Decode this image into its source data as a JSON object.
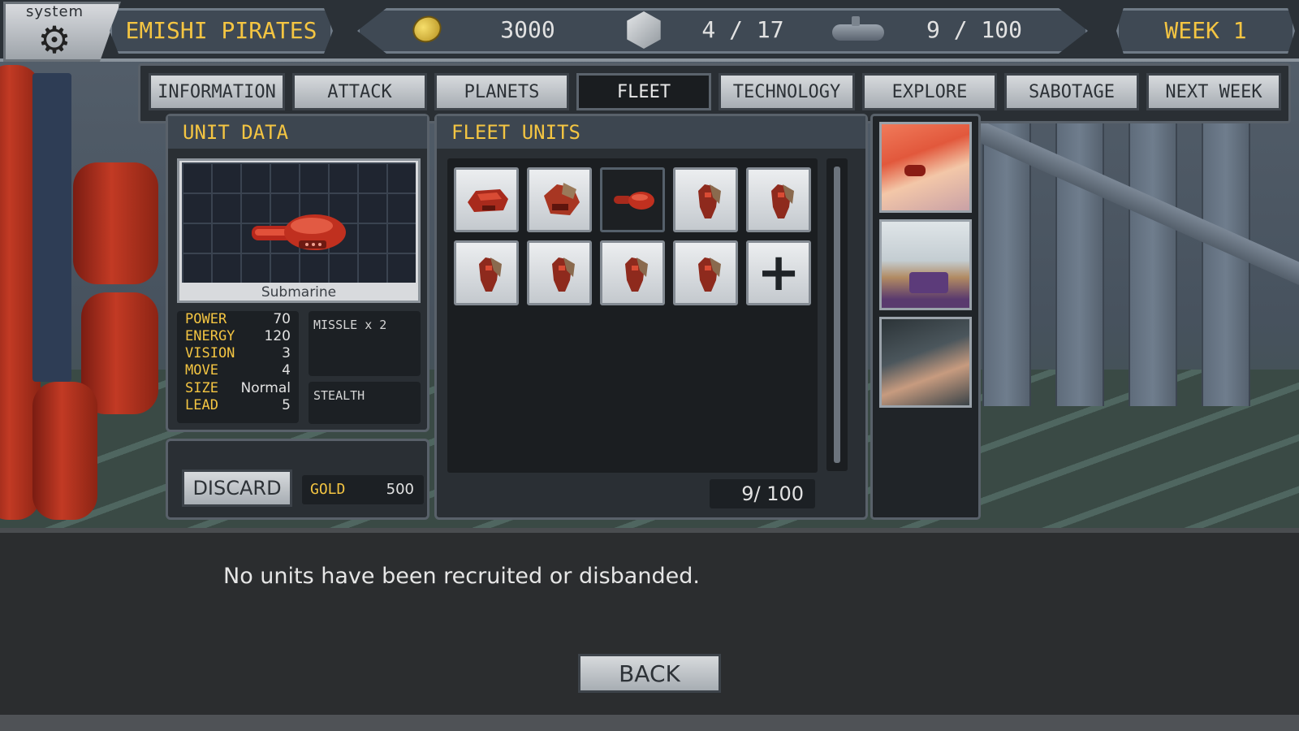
{
  "header": {
    "system_label": "system",
    "faction_name": "EMISHI PIRATES",
    "gold": "3000",
    "planets": "4 / 17",
    "fleet": "9 / 100",
    "week": "WEEK  1"
  },
  "tabs": [
    {
      "label": "INFORMATION",
      "active": false
    },
    {
      "label": "ATTACK",
      "active": false
    },
    {
      "label": "PLANETS",
      "active": false
    },
    {
      "label": "FLEET",
      "active": true
    },
    {
      "label": "TECHNOLOGY",
      "active": false
    },
    {
      "label": "EXPLORE",
      "active": false
    },
    {
      "label": "SABOTAGE",
      "active": false
    },
    {
      "label": "NEXT WEEK",
      "active": false
    }
  ],
  "unit_data": {
    "title": "UNIT DATA",
    "unit_name": "Submarine",
    "stats": [
      {
        "key": "POWER",
        "value": "70"
      },
      {
        "key": "ENERGY",
        "value": "120"
      },
      {
        "key": "VISION",
        "value": "3"
      },
      {
        "key": "MOVE",
        "value": "4"
      },
      {
        "key": "SIZE",
        "value": "Normal"
      },
      {
        "key": "LEAD",
        "value": "5"
      }
    ],
    "weapon": "MISSLE x 2",
    "ability": "STEALTH",
    "discard_label": "DISCARD",
    "gold_label": "GOLD",
    "gold_value": "500"
  },
  "fleet_units": {
    "title": "FLEET UNITS",
    "count": "9/ 100",
    "units": [
      "red-ship-icon",
      "brown-ship-icon",
      "submarine-icon",
      "mech-icon",
      "mech-icon",
      "mech-icon",
      "mech-icon",
      "mech-icon",
      "mech-icon"
    ],
    "selected_index": 2
  },
  "commanders": [
    "red-haired-commander-portrait",
    "masked-white-haired-commander-portrait",
    "dark-haired-commander-portrait"
  ],
  "footer": {
    "message": "No units have been recruited or disbanded.",
    "back_label": "BACK"
  },
  "colors": {
    "accent_yellow": "#f4c542",
    "panel_dark": "#2a2f34",
    "button_light": "#d7dadd"
  }
}
